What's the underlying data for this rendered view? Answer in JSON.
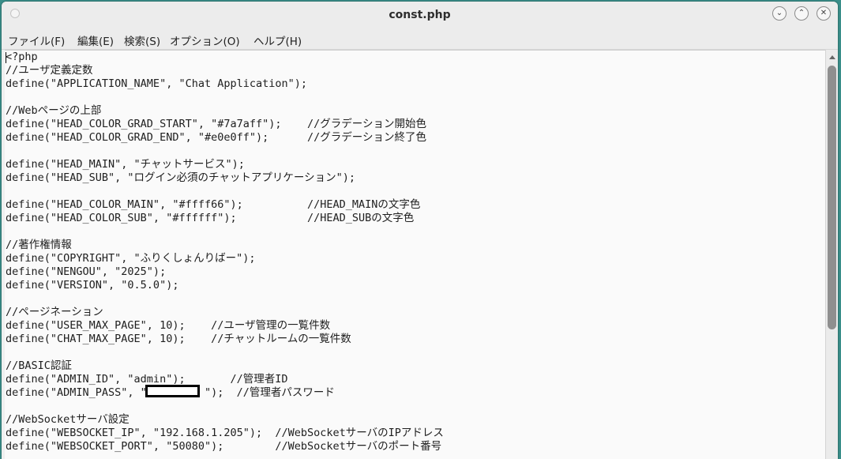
{
  "window": {
    "title": "const.php",
    "controls": [
      {
        "name": "minimize-icon",
        "glyph": "⌄"
      },
      {
        "name": "maximize-icon",
        "glyph": "⌃"
      },
      {
        "name": "close-icon",
        "glyph": "✕"
      }
    ]
  },
  "menu": {
    "items": [
      {
        "label": "ファイル(F)"
      },
      {
        "label": "編集(E)"
      },
      {
        "label": "検索(S)"
      },
      {
        "label": "オプション(O)"
      },
      {
        "label": "ヘルプ(H)"
      }
    ]
  },
  "editor": {
    "lines": [
      "<?php",
      "//ユーザ定義定数",
      "define(\"APPLICATION_NAME\", \"Chat Application\");",
      "",
      "//Webページの上部",
      "define(\"HEAD_COLOR_GRAD_START\", \"#7a7aff\");    //グラデーション開始色",
      "define(\"HEAD_COLOR_GRAD_END\", \"#e0e0ff\");      //グラデーション終了色",
      "",
      "define(\"HEAD_MAIN\", \"チャットサービス\");",
      "define(\"HEAD_SUB\", \"ログイン必須のチャットアプリケーション\");",
      "",
      "define(\"HEAD_COLOR_MAIN\", \"#ffff66\");          //HEAD_MAINの文字色",
      "define(\"HEAD_COLOR_SUB\", \"#ffffff\");           //HEAD_SUBの文字色",
      "",
      "//著作権情報",
      "define(\"COPYRIGHT\", \"ふりくしょんりばー\");",
      "define(\"NENGOU\", \"2025\");",
      "define(\"VERSION\", \"0.5.0\");",
      "",
      "//ページネーション",
      "define(\"USER_MAX_PAGE\", 10);    //ユーザ管理の一覧件数",
      "define(\"CHAT_MAX_PAGE\", 10);    //チャットルームの一覧件数",
      "",
      "//BASIC認証",
      "define(\"ADMIN_ID\", \"admin\");       //管理者ID",
      "define(\"ADMIN_PASS\", \"         \");  //管理者パスワード",
      "",
      "//WebSocketサーバ設定",
      "define(\"WEBSOCKET_IP\", \"192.168.1.205\");  //WebSocketサーバのIPアドレス",
      "define(\"WEBSOCKET_PORT\", \"50080\");        //WebSocketサーバのポート番号"
    ]
  }
}
